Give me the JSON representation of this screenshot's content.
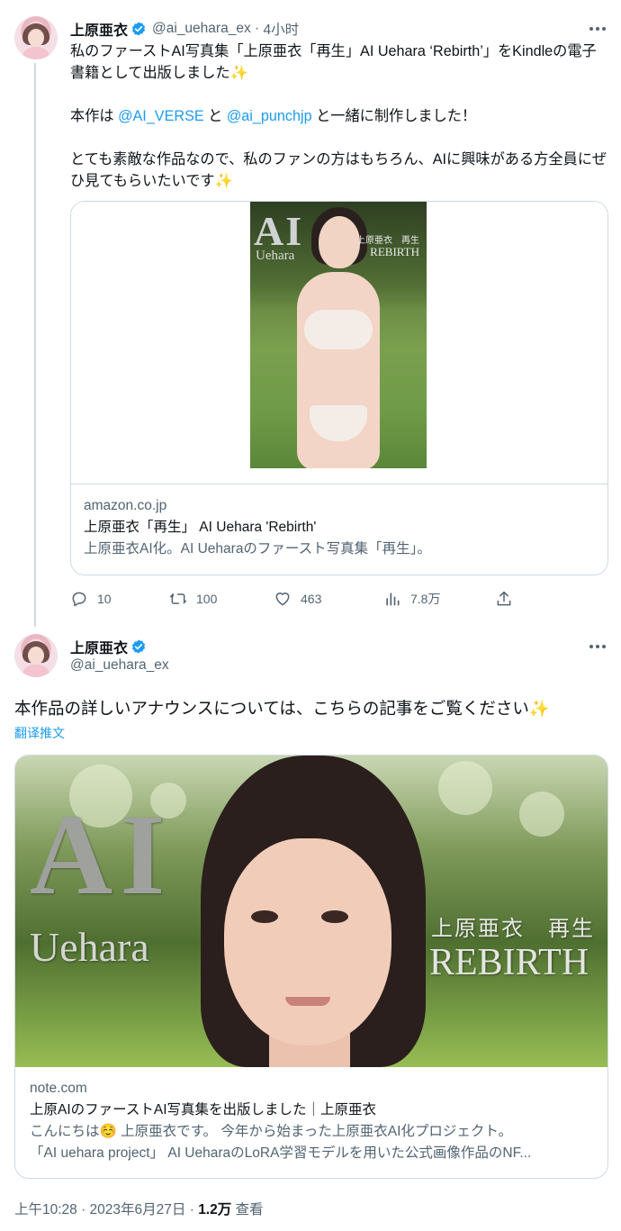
{
  "tweet1": {
    "name": "上原亜衣",
    "handle": "@ai_uehara_ex",
    "time": "4小时",
    "paragraph1": "私のファーストAI写真集「上原亜衣「再生」AI Uehara ‘Rebirth’」をKindleの電子書籍として出版しました✨",
    "p2_prefix": "本作は ",
    "mention1": "@AI_VERSE",
    "p2_middle": " と ",
    "mention2": "@ai_punchjp",
    "p2_suffix": " と一緒に制作しました！",
    "paragraph3": "とても素敵な作品なので、私のファンの方はもちろん、AIに興味がある方全員にぜひ見てもらいたいです✨",
    "card": {
      "cover_title": "AI",
      "cover_subtitle": "Uehara",
      "cover_jp": "上原亜衣　再生",
      "cover_rebirth": "REBIRTH",
      "domain": "amazon.co.jp",
      "title": "上原亜衣「再生」 AI Uehara 'Rebirth'",
      "description": "上原亜衣AI化。AI Ueharaのファースト写真集「再生」。"
    },
    "actions": {
      "replies": "10",
      "retweets": "100",
      "likes": "463",
      "views": "7.8万"
    }
  },
  "tweet2": {
    "name": "上原亜衣",
    "handle": "@ai_uehara_ex",
    "text": "本作品の詳しいアナウンスについては、こちらの記事をご覧ください✨",
    "translate": "翻译推文",
    "card": {
      "image_title": "AI",
      "image_subtitle": "Uehara",
      "image_jp": "上原亜衣　再生",
      "image_rebirth": "REBIRTH",
      "domain": "note.com",
      "title": "上原AIのファーストAI写真集を出版しました｜上原亜衣",
      "description_line1": "こんにちは☺️ 上原亜衣です。 今年から始まった上原亜衣AI化プロジェクト。",
      "description_line2": "「AI uehara project」 AI UeharaのLoRA学習モデルを用いた公式画像作品のNF..."
    },
    "timestamp": "上午10:28 · 2023年6月27日 · ",
    "views_count": "1.2万",
    "views_label": " 查看"
  },
  "colors": {
    "link": "#1d9bf0",
    "muted": "#536471",
    "border": "#cfd9de",
    "text": "#0f1419"
  }
}
